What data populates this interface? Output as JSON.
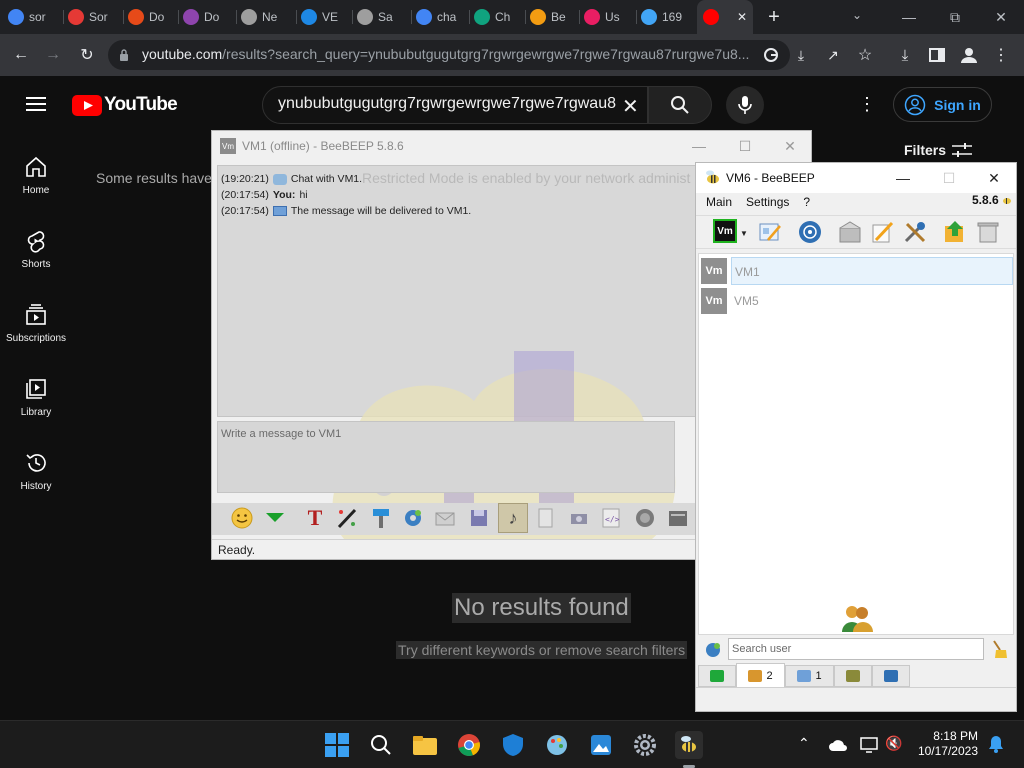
{
  "browser": {
    "tabs": [
      {
        "label": "sor",
        "icon": "google-icon",
        "color": "#4285f4"
      },
      {
        "label": "Sor",
        "icon": "sor-icon",
        "color": "#e53935"
      },
      {
        "label": "Do",
        "icon": "x-icon",
        "color": "#e64a19"
      },
      {
        "label": "Do",
        "icon": "deck-icon",
        "color": "#8e44ad"
      },
      {
        "label": "Ne",
        "icon": "bank-icon",
        "color": "#9e9e9e"
      },
      {
        "label": "VE",
        "icon": "v-icon",
        "color": "#1e88e5"
      },
      {
        "label": "Sa",
        "icon": "bank-icon",
        "color": "#9e9e9e"
      },
      {
        "label": "cha",
        "icon": "google-icon",
        "color": "#4285f4"
      },
      {
        "label": "Ch",
        "icon": "openai-icon",
        "color": "#10a37f"
      },
      {
        "label": "Be",
        "icon": "diamond-icon",
        "color": "#f39c12"
      },
      {
        "label": "Us",
        "icon": "heart-icon",
        "color": "#e91e63"
      },
      {
        "label": "169",
        "icon": "wave-icon",
        "color": "#42a5f5"
      },
      {
        "label": "",
        "icon": "youtube-icon",
        "color": "#ff0000"
      }
    ],
    "url_host": "youtube.com",
    "url_rest": "/results?search_query=ynububutgugutgrg7rgwrgewrgwe7rgwe7rgwau87rurgwe7u8..."
  },
  "youtube": {
    "logo_text": "YouTube",
    "search_value": "ynububutgugutgrg7rgwrgewrgwe7rgwe7rgwau8",
    "signin_label": "Sign in",
    "filters_label": "Filters",
    "nav": [
      {
        "label": "Home",
        "icon": "home-icon"
      },
      {
        "label": "Shorts",
        "icon": "shorts-icon"
      },
      {
        "label": "Subscriptions",
        "icon": "subscriptions-icon"
      },
      {
        "label": "Library",
        "icon": "library-icon"
      },
      {
        "label": "History",
        "icon": "history-icon"
      }
    ],
    "notice_text": "Some results have",
    "notice_tail": "Restricted Mode is enabled by your network administ",
    "no_results_title": "No results found",
    "no_results_hint": "Try different keywords or remove search filters"
  },
  "chat_window": {
    "title": "VM1 (offline) - BeeBEEP 5.8.6",
    "messages": [
      {
        "time": "(19:20:21)",
        "sender": "",
        "text": "Chat with VM1."
      },
      {
        "time": "(20:17:54)",
        "sender": "You:",
        "text": "hi"
      },
      {
        "time": "(20:17:54)",
        "sender": "",
        "text": "The message will be delivered to VM1."
      }
    ],
    "input_placeholder": "Write a message to VM1",
    "status": "Ready."
  },
  "main_window": {
    "title": "VM6 - BeeBEEP",
    "menu": [
      "Main",
      "Settings",
      "?"
    ],
    "version": "5.8.6",
    "users": [
      {
        "avatar": "Vm",
        "name": "VM1"
      },
      {
        "avatar": "Vm",
        "name": "VM5"
      }
    ],
    "search_placeholder": "Search user",
    "tabs": [
      {
        "icon": "chat-icon",
        "count": ""
      },
      {
        "icon": "users-icon",
        "count": "2"
      },
      {
        "icon": "chats-icon",
        "count": "1"
      },
      {
        "icon": "groups-icon",
        "count": ""
      },
      {
        "icon": "files-icon",
        "count": ""
      }
    ]
  },
  "taskbar": {
    "time": "8:18 PM",
    "date": "10/17/2023"
  }
}
